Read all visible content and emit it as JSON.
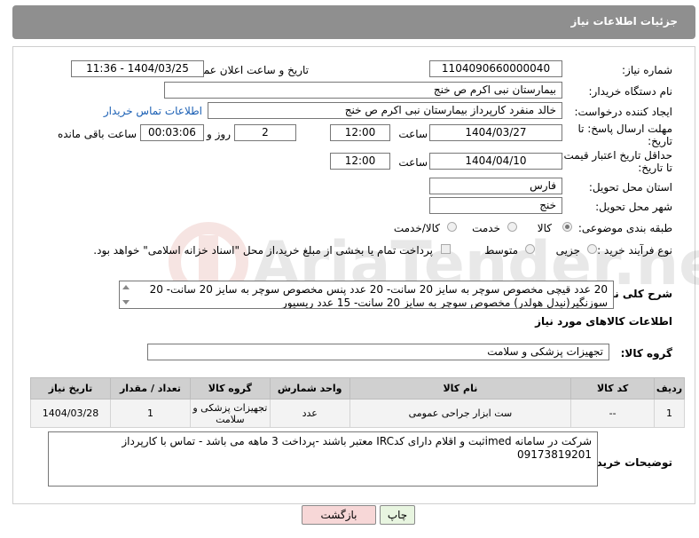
{
  "header": {
    "title": "جزئیات اطلاعات نیاز"
  },
  "labels": {
    "need_number": "شماره نیاز:",
    "announce_datetime": "تاریخ و ساعت اعلان عمومی:",
    "buyer_org": "نام دستگاه خریدار:",
    "requester": "ایجاد کننده درخواست:",
    "reply_deadline_1": "مهلت ارسال پاسخ: تا",
    "reply_deadline_2": "تاریخ:",
    "time": "ساعت",
    "day_and": "روز و",
    "remaining": "ساعت باقی مانده",
    "price_validity_1": "حداقل تاریخ اعتبار قیمت:",
    "price_validity_2": "تا تاریخ:",
    "province": "استان محل تحویل:",
    "city": "شهر محل تحویل:",
    "category": "طبقه بندی موضوعی:",
    "process_type": "نوع فرآیند خرید :",
    "description": "شرح کلی نیاز:",
    "items_title": "اطلاعات کالاهای مورد نیاز",
    "goods_group": "گروه کالا:",
    "buyer_notes": "توضیحات خریدار:"
  },
  "fields": {
    "need_number": "1104090660000040",
    "announce_datetime": "1404/03/25 - 11:36",
    "buyer_org": "بیمارستان نبی اکرم  ص  خنج",
    "requester": "خالد منفرد کارپرداز بیمارستان نبی اکرم  ص  خنج",
    "buyer_contact_link": "اطلاعات تماس خریدار",
    "reply_date": "1404/03/27",
    "reply_time": "12:00",
    "reply_days": "2",
    "remaining_time": "00:03:06",
    "price_date": "1404/04/10",
    "price_time": "12:00",
    "province": "فارس",
    "city": "خنج",
    "goods_group": "تجهیزات پزشکی و سلامت",
    "description_line1": "20 عدد قیچی مخصوص سوچر به سایز 20 سانت- 20 عدد پنس مخصوص سوچر به سایز 20 سانت- 20",
    "description_line2": "سوزنگیر(نیدل هولدر) مخصوص سوچر به سایز 20 سانت- 15 عدد ریسیور",
    "buyer_notes": "شرکت در سامانه imedثبت و اقلام دارای کدIRC معتبر باشند -پرداخت 3 ماهه می باشد - تماس با کارپرداز 09173819201"
  },
  "category_options": [
    {
      "label": "کالا",
      "selected": true
    },
    {
      "label": "خدمت",
      "selected": false
    },
    {
      "label": "کالا/خدمت",
      "selected": false
    }
  ],
  "process_options": [
    {
      "label": "جزیی",
      "selected": false
    },
    {
      "label": "متوسط",
      "selected": false
    }
  ],
  "payment_note": "پرداخت تمام یا بخشی از مبلغ خرید،از محل \"اسناد خزانه اسلامی\" خواهد بود.",
  "table": {
    "headers": [
      "ردیف",
      "کد کالا",
      "نام کالا",
      "واحد شمارش",
      "گروه کالا",
      "تعداد / مقدار",
      "تاریخ نیاز"
    ],
    "rows": [
      [
        "1",
        "--",
        "ست ابزار جراحی عمومی",
        "عدد",
        "تجهیزات پزشکی و سلامت",
        "1",
        "1404/03/28"
      ]
    ]
  },
  "buttons": {
    "print": "چاپ",
    "back": "بازگشت"
  },
  "colors": {
    "header_bg": "#8f8f8f",
    "link": "#1a5fb4",
    "back_btn_bg": "#f7d7d7",
    "print_btn_bg": "#e8f5e0"
  },
  "watermark_text": "AriaTender.neT"
}
